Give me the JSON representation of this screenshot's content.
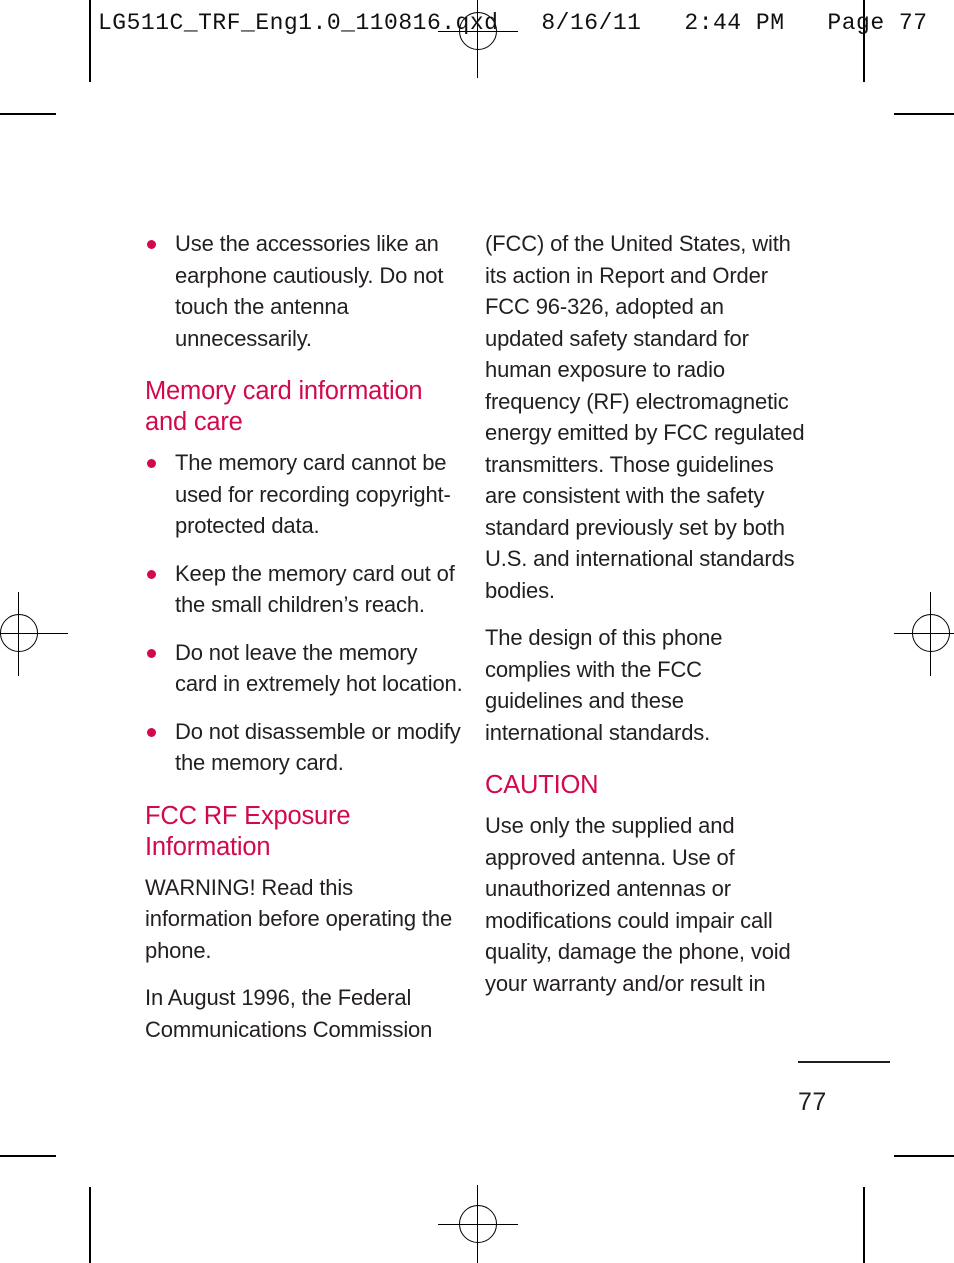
{
  "proof_header": "LG511C_TRF_Eng1.0_110816.qxd   8/16/11   2:44 PM   Page 77",
  "colors": {
    "heading": "#d1094f",
    "body": "#231f20",
    "bullet": "#d1094f"
  },
  "left_column": {
    "top_bullets": [
      "Use the accessories like an earphone cautiously. Do not touch the antenna unnecessarily."
    ],
    "heading_memory": "Memory card information and care",
    "memory_bullets": [
      "The memory card cannot be used for recording copyright-protected data.",
      "Keep the memory card out of the small children’s reach.",
      "Do not leave the memory card in extremely hot location.",
      "Do not disassemble or modify the memory card."
    ],
    "heading_fcc": "FCC RF Exposure Information",
    "paragraphs": [
      "WARNING! Read this information before operating the phone.",
      "In August 1996, the Federal Communications Commission"
    ]
  },
  "right_column": {
    "paragraphs_top": [
      "(FCC) of the United States, with its action in Report and Order FCC 96-326, adopted an updated safety standard for human exposure to radio frequency (RF) electromagnetic energy emitted by FCC regulated transmitters. Those guidelines are consistent with the safety standard previously set by both U.S. and international standards bodies.",
      "The design of this phone complies with the FCC guidelines and these international standards."
    ],
    "heading_caution": "CAUTION",
    "paragraphs_bottom": [
      "Use only the supplied and approved antenna. Use of unauthorized antennas or modifications could impair call quality, damage the phone, void your warranty and/or result in"
    ]
  },
  "footer": {
    "page_number": "77"
  }
}
